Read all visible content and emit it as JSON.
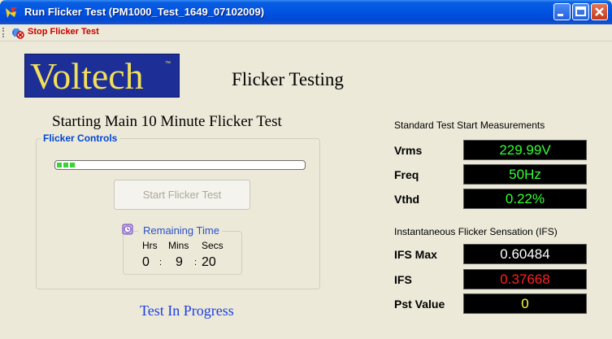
{
  "window": {
    "title": "Run Flicker Test (PM1000_Test_1649_07102009)"
  },
  "menu": {
    "stop_label": "Stop Flicker Test"
  },
  "logo": {
    "text": "Voltech",
    "tm": "™"
  },
  "header": {
    "title": "Flicker Testing"
  },
  "status": {
    "heading": "Starting Main 10 Minute Flicker Test",
    "progress_text": "Test In Progress"
  },
  "flicker_controls": {
    "group_label": "Flicker Controls",
    "progress_fraction": 0.03,
    "start_button_label": "Start Flicker Test",
    "remaining_time": {
      "label": "Remaining Time",
      "hrs_label": "Hrs",
      "mins_label": "Mins",
      "secs_label": "Secs",
      "hrs": "0",
      "mins": "9",
      "secs": "20",
      "separator": ":"
    }
  },
  "standard_measurements": {
    "title": "Standard Test Start Measurements",
    "vrms_label": "Vrms",
    "vrms_value": "229.99V",
    "freq_label": "Freq",
    "freq_value": "50Hz",
    "vthd_label": "Vthd",
    "vthd_value": "0.22%",
    "color": "#33ff33"
  },
  "ifs": {
    "title": "Instantaneous Flicker Sensation (IFS)",
    "max_label": "IFS Max",
    "max_value": "0.60484",
    "max_color": "#ffffff",
    "ifs_label": "IFS",
    "ifs_value": "0.37668",
    "ifs_color": "#ff2020",
    "pst_label": "Pst Value",
    "pst_value": "0",
    "pst_color": "#ffff33"
  }
}
